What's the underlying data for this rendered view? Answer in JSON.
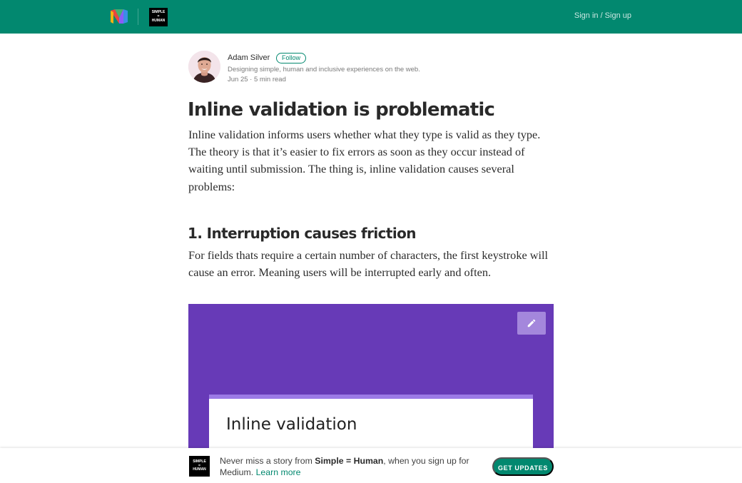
{
  "topbar": {
    "publication_logo_lines": [
      "SIMPLE",
      "=",
      "HUMAN"
    ],
    "signin_label": "Sign in / Sign up",
    "background_color": "#02886f"
  },
  "author": {
    "name": "Adam Silver",
    "follow_label": "Follow",
    "bio": "Designing simple, human and inclusive experiences on the web.",
    "date": "Jun 25",
    "separator": "·",
    "read_time": "5 min read"
  },
  "article": {
    "title": "Inline validation is problematic",
    "intro": "Inline validation informs users whether what they type is valid as they type. The theory is that it’s easier to fix errors as soon as they occur instead of waiting until submission. The thing is, inline validation causes several problems:",
    "section1_heading": "1. Interruption causes friction",
    "section1_text": "For fields thats require a certain number of characters, the first keystroke will cause an error. Meaning users will be interrupted early and often.",
    "figure": {
      "card_title": "Inline validation",
      "background_color": "#673ab7",
      "edit_icon": "pencil-icon"
    }
  },
  "bottombar": {
    "logo_lines": [
      "SIMPLE",
      "=",
      "HUMAN"
    ],
    "text_prefix": "Never miss a story from ",
    "publication_name": "Simple = Human",
    "text_suffix": ", when you sign up for Medium. ",
    "learn_more_label": "Learn more",
    "cta_label": "GET UPDATES",
    "accent_color": "#02886f"
  }
}
